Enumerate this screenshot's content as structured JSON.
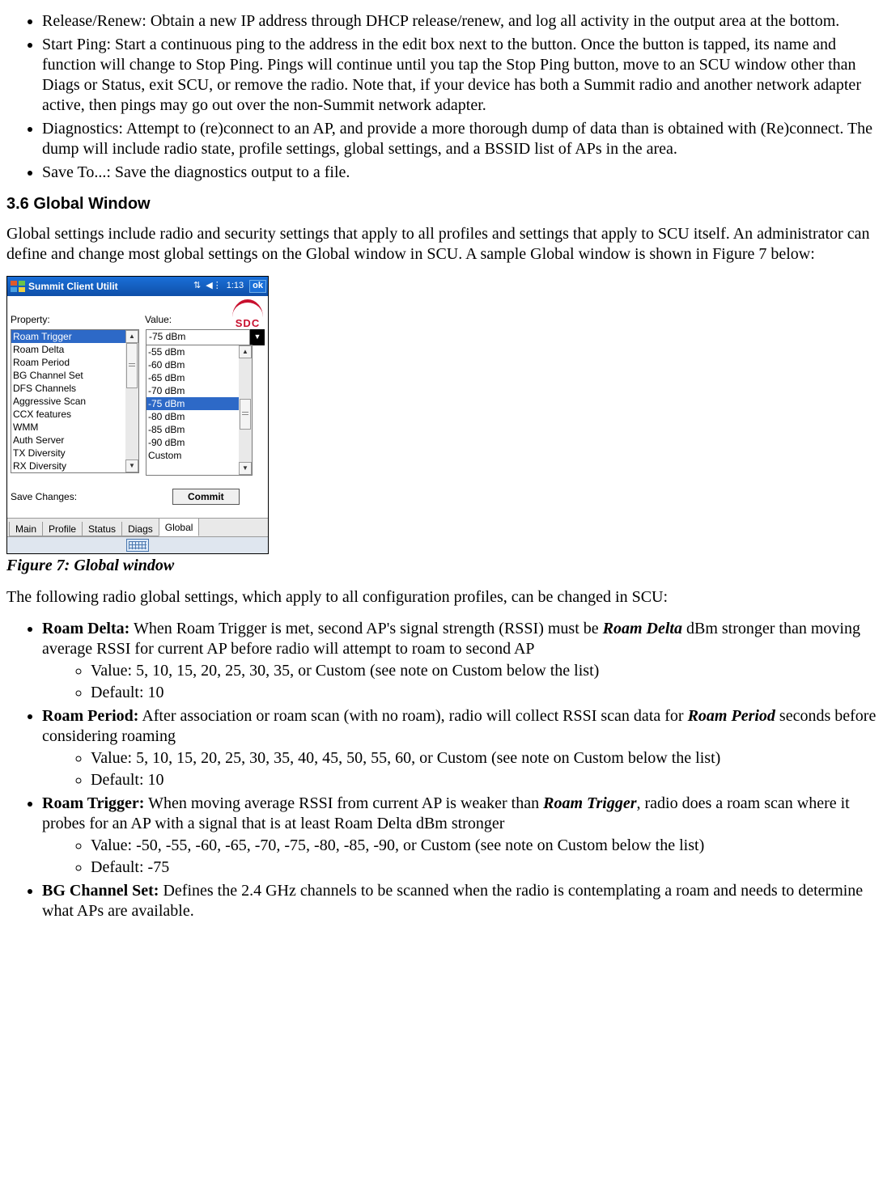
{
  "top_bullets": [
    "Release/Renew: Obtain a new IP address through DHCP release/renew, and log all activity in the output area at the bottom.",
    "Start Ping: Start a continuous ping to the address in the edit box next to the button. Once the button is tapped, its name and function will change to Stop Ping. Pings will continue until you tap the Stop Ping button, move to an SCU window other than Diags or Status, exit SCU, or remove the radio. Note that, if your device has both a Summit radio and another network adapter active, then pings may go out over the non-Summit network adapter.",
    "Diagnostics: Attempt to (re)connect to an AP, and provide a more thorough dump of data than is obtained with (Re)connect. The dump will include radio state, profile settings, global settings, and a BSSID list of APs in the area.",
    "Save To...: Save the diagnostics output to a file."
  ],
  "section_heading": "3.6 Global Window",
  "intro_para": "Global settings include radio and security settings that apply to all profiles and settings that apply to SCU itself. An administrator can define and change most global settings on the Global window in SCU. A sample Global window is shown in Figure 7 below:",
  "fig_caption": "Figure 7: Global window",
  "post_fig_para": "The following radio global settings, which apply to all configuration profiles, can be changed in SCU:",
  "settings": [
    {
      "name": "Roam Delta:",
      "desc_pre": " When Roam Trigger is met, second AP's signal strength (RSSI) must be ",
      "em": "Roam Delta",
      "desc_post": " dBm stronger than moving average RSSI for current AP  before radio will attempt to roam to second AP",
      "value": "Value: 5, 10, 15, 20, 25, 30, 35, or Custom (see note on Custom below the list)",
      "default": "Default: 10"
    },
    {
      "name": "Roam Period:",
      "desc_pre": " After association or roam scan (with no roam), radio will collect RSSI scan data for ",
      "em": "Roam Period",
      "desc_post": " seconds before considering roaming",
      "value": "Value: 5, 10, 15, 20, 25, 30, 35, 40, 45, 50, 55, 60, or Custom (see note on Custom below the list)",
      "default": "Default: 10"
    },
    {
      "name": "Roam Trigger:",
      "desc_pre": " When moving average RSSI from current AP is weaker than ",
      "em": "Roam Trigger",
      "desc_post": ", radio does a roam scan where it probes for an AP with a signal that is at least Roam Delta dBm stronger",
      "value": "Value: -50, -55, -60, -65, -70, -75, -80, -85, -90, or Custom (see note on Custom below the list)",
      "default": "Default: -75"
    },
    {
      "name": "BG Channel Set:",
      "desc_pre": " Defines the 2.4 GHz channels to be scanned when the radio is contemplating a roam and needs to determine what APs are available.",
      "em": "",
      "desc_post": "",
      "value": "",
      "default": ""
    }
  ],
  "device": {
    "title": "Summit Client Utilit",
    "time": "1:13",
    "ok": "ok",
    "logo": "SDC",
    "prop_label": "Property:",
    "val_label": "Value:",
    "properties": [
      "Roam Trigger",
      "Roam Delta",
      "Roam Period",
      "BG Channel Set",
      "DFS Channels",
      "Aggressive Scan",
      "CCX features",
      "WMM",
      "Auth Server",
      "TX Diversity",
      "RX Diversity"
    ],
    "prop_selected_index": 0,
    "value_selected": "-75 dBm",
    "values": [
      "-55 dBm",
      "-60 dBm",
      "-65 dBm",
      "-70 dBm",
      "-75 dBm",
      "-80 dBm",
      "-85 dBm",
      "-90 dBm",
      "Custom"
    ],
    "val_selected_index": 4,
    "save_label": "Save Changes:",
    "commit": "Commit",
    "tabs": [
      "Main",
      "Profile",
      "Status",
      "Diags",
      "Global"
    ],
    "active_tab_index": 4
  }
}
